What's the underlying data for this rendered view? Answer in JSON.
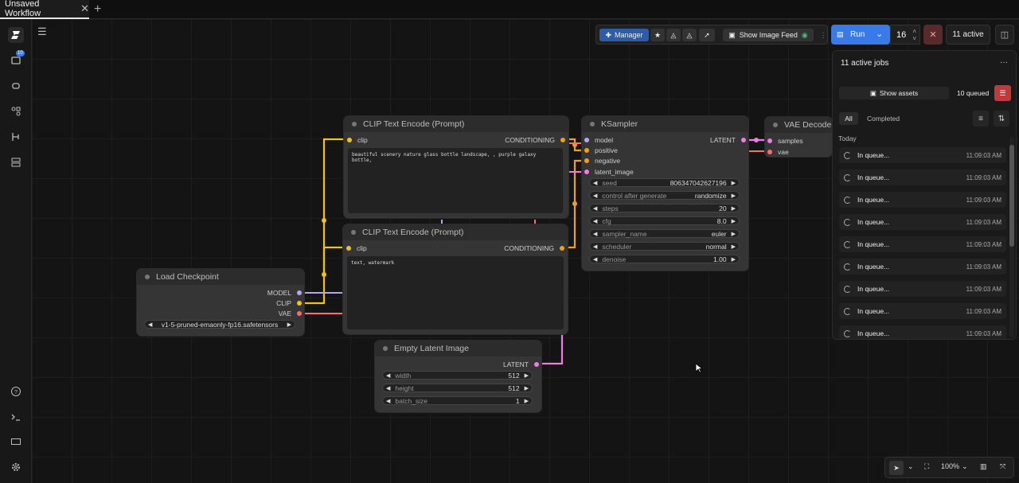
{
  "tabs": {
    "active": "Unsaved Workflow",
    "close": "✕",
    "add": "+"
  },
  "sidebar": {
    "badge": "10"
  },
  "toolbar": {
    "manager": "Manager",
    "feed": "Show Image Feed",
    "run": "Run",
    "batch": "16",
    "active": "11 active"
  },
  "queue": {
    "title": "11 active jobs",
    "more": "···",
    "show_assets": "Show assets",
    "queued": "10 queued",
    "tab_all": "All",
    "tab_completed": "Completed",
    "today": "Today",
    "rows": [
      {
        "status": "In queue...",
        "time": "11:09:03 AM"
      },
      {
        "status": "In queue...",
        "time": "11:09:03 AM"
      },
      {
        "status": "In queue...",
        "time": "11:09:03 AM"
      },
      {
        "status": "In queue...",
        "time": "11:09:03 AM"
      },
      {
        "status": "In queue...",
        "time": "11:09:03 AM"
      },
      {
        "status": "In queue...",
        "time": "11:09:03 AM"
      },
      {
        "status": "In queue...",
        "time": "11:09:03 AM"
      },
      {
        "status": "In queue...",
        "time": "11:09:03 AM"
      },
      {
        "status": "In queue...",
        "time": "11:09:03 AM"
      }
    ]
  },
  "nodes": {
    "clip1": {
      "title": "CLIP Text Encode (Prompt)",
      "in": "clip",
      "out": "CONDITIONING",
      "text": "beautiful scenery nature glass bottle landscape, , purple galaxy bottle,"
    },
    "clip2": {
      "title": "CLIP Text Encode (Prompt)",
      "in": "clip",
      "out": "CONDITIONING",
      "text": "text, watermark"
    },
    "ksampler": {
      "title": "KSampler",
      "inputs": [
        "model",
        "positive",
        "negative",
        "latent_image"
      ],
      "out": "LATENT",
      "widgets": [
        {
          "name": "seed",
          "value": "806347042627196"
        },
        {
          "name": "control after generate",
          "value": "randomize"
        },
        {
          "name": "steps",
          "value": "20"
        },
        {
          "name": "cfg",
          "value": "8.0"
        },
        {
          "name": "sampler_name",
          "value": "euler"
        },
        {
          "name": "scheduler",
          "value": "normal"
        },
        {
          "name": "denoise",
          "value": "1.00"
        }
      ]
    },
    "vae": {
      "title": "VAE Decode",
      "inputs": [
        "samples",
        "vae"
      ]
    },
    "checkpoint": {
      "title": "Load Checkpoint",
      "outputs": [
        "MODEL",
        "CLIP",
        "VAE"
      ],
      "ckpt": "v1-5-pruned-emaonly-fp16.safetensors"
    },
    "latent": {
      "title": "Empty Latent Image",
      "out": "LATENT",
      "widgets": [
        {
          "name": "width",
          "value": "512"
        },
        {
          "name": "height",
          "value": "512"
        },
        {
          "name": "batch_size",
          "value": "1"
        }
      ]
    }
  },
  "bottom": {
    "zoom": "100%"
  }
}
